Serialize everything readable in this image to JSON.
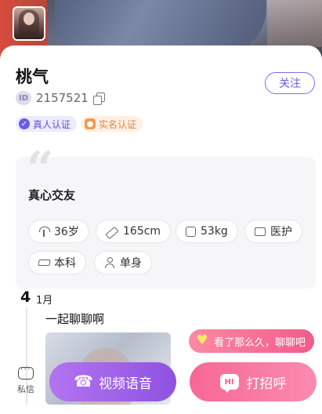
{
  "profile": {
    "name": "桃气",
    "id_badge": "ID",
    "id": "2157521",
    "follow_label": "关注",
    "badges": [
      {
        "label": "真人认证"
      },
      {
        "label": "实名认证"
      }
    ]
  },
  "intro": {
    "text": "真心交友",
    "tags": [
      "36岁",
      "165cm",
      "53kg",
      "医护",
      "本科",
      "单身"
    ]
  },
  "moment": {
    "day": "4",
    "month": "1月",
    "text": "一起聊聊啊"
  },
  "bottom": {
    "bubble_text": "看了那么久，聊聊吧",
    "message_label": "私信",
    "video_label": "视频语音",
    "greet_label": "打招呼",
    "greet_icon_text": "HI"
  },
  "colors": {
    "accent": "#6a5ce8",
    "video_btn": "#9d5ce8",
    "greet_btn": "#f76796"
  }
}
